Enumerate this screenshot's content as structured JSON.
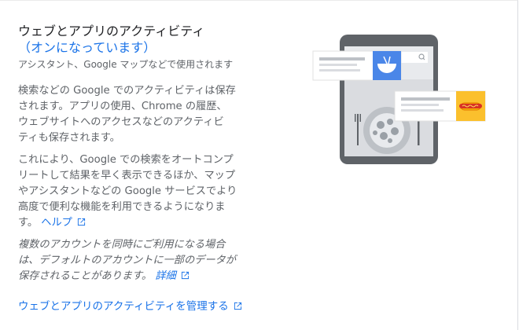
{
  "section": {
    "title": "ウェブとアプリのアクティビティ",
    "status": "（オンになっています）",
    "subtitle": "アシスタント、Google マップなどで使用されます"
  },
  "paragraphs": {
    "p1_lines": [
      "検索などの Google でのアクティビティは保存",
      "されます。アプリの使用、Chrome の履歴、",
      "ウェブサイトへのアクセスなどのアクティビ",
      "ティも保存されます。"
    ],
    "p2_lines": [
      "これにより、Google での検索をオートコンプ",
      "リートして結果を早く表示できるほか、マップ",
      "やアシスタントなどの Google サービスでより",
      "高度で便利な機能を利用できるようになりま"
    ],
    "p2_last": "す。",
    "help_link": "ヘルプ",
    "p3_lines": [
      "複数のアカウントを同時にご利用になる場合",
      "は、デフォルトのアカウントに一部のデータが"
    ],
    "p3_last": "保存されることがあります。",
    "details_link": "詳細"
  },
  "manage_link": "ウェブとアプリのアクティビティを管理する",
  "colors": {
    "link": "#1a73e8",
    "body_text": "#5f6368",
    "title": "#202124",
    "card_blue": "#4a86e8",
    "card_yellow": "#fbc02d"
  },
  "icons": [
    "open-in-new-icon",
    "ramen-bowl-icon",
    "hot-dog-icon",
    "fork-icon",
    "search-icon"
  ]
}
